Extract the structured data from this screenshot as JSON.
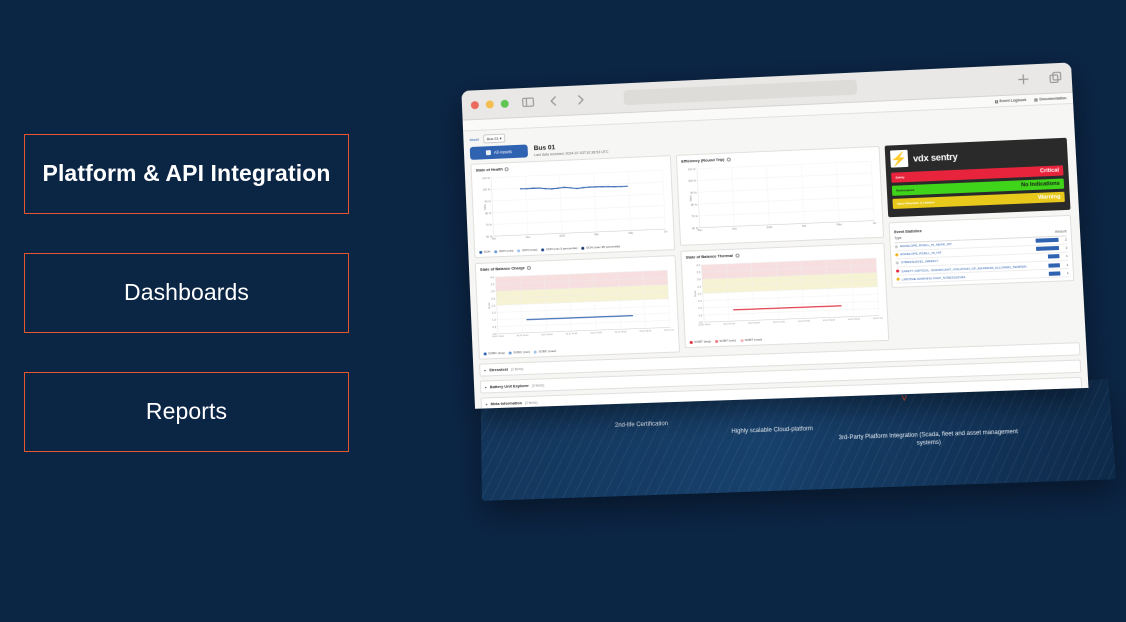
{
  "background": {
    "top_color": "#0a2141",
    "bottom_color": "#336490",
    "accent_orange": "#e8562d"
  },
  "left_panel": {
    "boxes": [
      {
        "label": "Platform & API Integration"
      },
      {
        "label": "Dashboards"
      },
      {
        "label": "Reports"
      }
    ]
  },
  "browser": {
    "traffic_lights": [
      "close",
      "minimize",
      "maximize"
    ],
    "sidebar_icon": "sidebar-toggle-icon",
    "back_icon": "chevron-left-icon",
    "forward_icon": "chevron-right-icon",
    "url_value": "",
    "url_placeholder": "",
    "new_tab_icon": "plus-icon",
    "tab_overview_icon": "copy-tabs-icon"
  },
  "app": {
    "top_links": [
      {
        "label": "Event Logbook",
        "icon": "list-icon"
      },
      {
        "label": "Documentation",
        "icon": "book-icon"
      }
    ],
    "breadcrumb": {
      "root": "Asset",
      "current": "Bus 01 ▾"
    },
    "all_assets_button": "All Assets",
    "asset_title": "Bus 01",
    "asset_subtitle": "Last data received: 2024-07-03T10:38:53 UTC",
    "accordions": [
      {
        "label": "Stresstest",
        "count": "(2 items)"
      },
      {
        "label": "Battery Unit Explorer",
        "count": "(2 items)"
      },
      {
        "label": "Meta Information",
        "count": "(2 items)"
      }
    ]
  },
  "sentry": {
    "logo_glyph": "⚡",
    "name": "vdx sentry",
    "rows": [
      {
        "label": "Safety",
        "status": "Critical",
        "color": "#e8243c",
        "text_color": "#ffffff"
      },
      {
        "label": "Performance",
        "status": "No Indications",
        "color": "#3fd41a",
        "text_color": "#1b1b1b"
      },
      {
        "label": "Value Retention & Lifetime",
        "status": "Warning",
        "color": "#e8c81a",
        "text_color": "#ffffff"
      }
    ],
    "events_title": "Event Statistics",
    "events_columns": [
      "Type",
      "Amount"
    ],
    "events": [
      {
        "severity": "none",
        "color": "#cccccc",
        "type": "ENVELOPE_RCELL_HI_NEAR_HIT",
        "amount": "2",
        "bar_pct": 100
      },
      {
        "severity": "warning",
        "color": "#f0b41a",
        "type": "ENVELOPE_RCELL_HI_HIT",
        "amount": "2",
        "bar_pct": 100
      },
      {
        "severity": "none",
        "color": "#cccccc",
        "type": "STRESSLEVEL_WEEKLY",
        "amount": "1",
        "bar_pct": 52
      },
      {
        "severity": "critical",
        "color": "#e8243c",
        "type": "SAFETY CRITICAL: SIGNIFICANT_VIOLATION_OF_MAXIMUM_ALLOWED_TEMPERATURE",
        "amount": "1",
        "bar_pct": 52
      },
      {
        "severity": "warning",
        "color": "#f0b41a",
        "type": "LIFETIME WARNING HIGH_STRESSLEVEL",
        "amount": "1",
        "bar_pct": 52
      }
    ]
  },
  "base_captions": [
    {
      "text": "2nd-life Certification"
    },
    {
      "text": "Highly scalable Cloud-platform"
    },
    {
      "text": "3rd-Party Platform Integration (Scada, fleet and asset management systems)"
    }
  ],
  "chart_data": [
    {
      "id": "state-of-health",
      "type": "line",
      "title": "State of Health",
      "xlabel": "",
      "ylabel": "Value",
      "ylim": [
        60,
        110
      ],
      "yticks": [
        "110 %",
        "100 %",
        "90 %",
        "80 %",
        "70 %",
        "60 %"
      ],
      "x": [
        "Sep",
        "Nov",
        "2024",
        "Mar",
        "May",
        "Jul"
      ],
      "grid": true,
      "legend_position": "bottom",
      "series": [
        {
          "name": "SOH",
          "color": "#2f62b0",
          "values": [
            99.4,
            99.2,
            99.5,
            99.3,
            98.6,
            98.2,
            98.6,
            99.0,
            98.4,
            97.6,
            98.1,
            98.4,
            98.3,
            98.2,
            98.0,
            97.8,
            97.6,
            97.7
          ]
        }
      ],
      "legend": [
        {
          "label": "SOH",
          "color": "#2f62b0"
        },
        {
          "label": "SOH (min)",
          "color": "#6a9ad6"
        },
        {
          "label": "SOH (max)",
          "color": "#9fc2e8"
        },
        {
          "label": "SOH (min 5 percentile)",
          "color": "#24488a"
        },
        {
          "label": "SOH (max 95 percentile)",
          "color": "#1d3a70"
        }
      ]
    },
    {
      "id": "efficiency-round-trip",
      "type": "line",
      "title": "Efficiency (Round Trip)",
      "xlabel": "",
      "ylabel": "Value",
      "ylim": [
        60,
        110
      ],
      "yticks": [
        "110 %",
        "100 %",
        "90 %",
        "80 %",
        "70 %",
        "60 %"
      ],
      "x": [
        "Sep",
        "Nov",
        "2024",
        "Mar",
        "May",
        "Jul"
      ],
      "grid": true,
      "legend_position": "bottom",
      "series": [
        {
          "name": "Efficiency",
          "color": "#2f62b0",
          "values": []
        }
      ],
      "legend": []
    },
    {
      "id": "state-of-balance-charge",
      "type": "line",
      "title": "State of Balance Charge",
      "xlabel": "",
      "ylabel": "Score",
      "ylim": [
        0.0,
        4.0
      ],
      "yticks": [
        "4.0",
        "3.5",
        "3.0",
        "2.5",
        "2.0",
        "1.5",
        "1.0",
        "0.5",
        "0.0"
      ],
      "x": [
        "03-07 18:00",
        "04-07 00:00",
        "04-07 06:00",
        "04-07 12:00",
        "04-07 18:00",
        "05-07 00:00",
        "05-07 06:00",
        "05-07 12:00"
      ],
      "grid": true,
      "bands": [
        {
          "from": 3.0,
          "to": 4.0,
          "color": "#f7dfe0"
        },
        {
          "from": 2.0,
          "to": 3.0,
          "color": "#f6f2d4"
        }
      ],
      "legend_position": "bottom",
      "series": [
        {
          "name": "SOBC (avg)",
          "color": "#2f62b0",
          "values": [
            0.92,
            0.92,
            0.92,
            0.92,
            0.92,
            0.92
          ]
        }
      ],
      "legend": [
        {
          "label": "SOBC (avg)",
          "color": "#2f62b0"
        },
        {
          "label": "SOBC (min)",
          "color": "#6a9ad6"
        },
        {
          "label": "SOBC (max)",
          "color": "#9fc2e8"
        }
      ]
    },
    {
      "id": "state-of-balance-thermal",
      "type": "line",
      "title": "State of Balance Thermal",
      "xlabel": "",
      "ylabel": "Score",
      "ylim": [
        0.0,
        4.0
      ],
      "yticks": [
        "4.0",
        "3.5",
        "3.0",
        "2.5",
        "2.0",
        "1.5",
        "1.0",
        "0.5",
        "0.0"
      ],
      "x": [
        "03-07 18:00",
        "04-07 00:00",
        "04-07 06:00",
        "04-07 12:00",
        "04-07 18:00",
        "05-07 00:00",
        "05-07 06:00",
        "05-07 12:00"
      ],
      "grid": true,
      "bands": [
        {
          "from": 3.0,
          "to": 4.0,
          "color": "#f7dfe0"
        },
        {
          "from": 2.0,
          "to": 3.0,
          "color": "#f6f2d4"
        }
      ],
      "legend_position": "bottom",
      "series": [
        {
          "name": "SOBT (avg)",
          "color": "#e02b3c",
          "values": [
            0.78,
            0.78,
            0.78,
            0.78,
            0.78,
            0.78
          ]
        }
      ],
      "legend": [
        {
          "label": "SOBT (avg)",
          "color": "#e02b3c"
        },
        {
          "label": "SOBT (min)",
          "color": "#ef7b86"
        },
        {
          "label": "SOBT (max)",
          "color": "#f7b3ba"
        }
      ]
    }
  ]
}
